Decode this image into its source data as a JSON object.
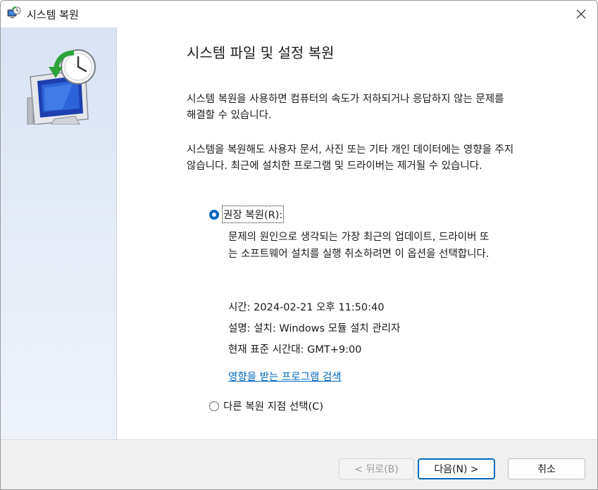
{
  "window": {
    "title": "시스템 복원",
    "close_icon": "close-icon",
    "app_icon": "system-restore-icon"
  },
  "main": {
    "heading": "시스템 파일 및 설정 복원",
    "para1_line1": "시스템 복원을 사용하면 컴퓨터의 속도가 저하되거나 응답하지 않는 문제를",
    "para1_line2": "해결할 수 있습니다.",
    "para2_line1": "시스템을 복원해도 사용자 문서, 사진 또는 기타 개인 데이터에는 영향을 주지",
    "para2_line2": "않습니다. 최근에 설치한 프로그램 및 드라이버는 제거될 수 있습니다.",
    "option_recommended": {
      "label": "권장 복원(R):",
      "selected": true,
      "desc_line1": "문제의 원인으로 생각되는 가장 최근의 업데이트, 드라이버 또",
      "desc_line2": "는 소프트웨어 설치를 실행 취소하려면 이 옵션을 선택합니다.",
      "time": "시간: 2024-02-21 오후 11:50:40",
      "description": "설명: 설치: Windows 모듈 설치 관리자",
      "timezone": "현재 표준 시간대: GMT+9:00",
      "scan_link": "영향을 받는 프로그램 검색"
    },
    "option_other": {
      "label": "다른 복원 지점 선택(C)",
      "selected": false
    }
  },
  "footer": {
    "back_label": "< 뒤로(B)",
    "next_label": "다음(N) >",
    "cancel_label": "취소"
  },
  "colors": {
    "accent": "#0067c0",
    "side_panel": "#dfe7f5",
    "footer_bg": "#f0f0f0"
  }
}
